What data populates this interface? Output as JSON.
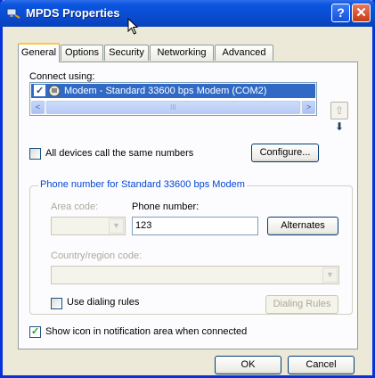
{
  "window": {
    "title": "MPDS Properties",
    "help_glyph": "?",
    "close_glyph": "✕"
  },
  "tabs": [
    {
      "label": "General",
      "active": true
    },
    {
      "label": "Options",
      "active": false
    },
    {
      "label": "Security",
      "active": false
    },
    {
      "label": "Networking",
      "active": false
    },
    {
      "label": "Advanced",
      "active": false
    }
  ],
  "connect": {
    "label": "Connect using:",
    "device": "Modem - Standard 33600 bps Modem (COM2)",
    "device_checked": true
  },
  "scroll": {
    "left_glyph": "<",
    "right_glyph": ">",
    "thumb_glyph": "III"
  },
  "move": {
    "up_glyph": "⇧",
    "down_glyph": "⬇"
  },
  "all_devices": {
    "label": "All devices call the same numbers",
    "checked": false
  },
  "configure_button": "Configure...",
  "phone_group": {
    "title": "Phone number for Standard 33600 bps Modem",
    "area_code_label": "Area code:",
    "phone_label": "Phone number:",
    "phone_value": "123",
    "alternates_button": "Alternates",
    "country_label": "Country/region code:",
    "dialing_rules_label": "Use dialing rules",
    "dialing_rules_checked": false,
    "dialing_rules_button": "Dialing Rules"
  },
  "show_icon": {
    "label": "Show icon in notification area when connected",
    "checked": true
  },
  "footer": {
    "ok": "OK",
    "cancel": "Cancel"
  },
  "colors": {
    "titlebar": "#0a4bd0",
    "selection": "#316ac5",
    "group_title": "#0046d5"
  }
}
